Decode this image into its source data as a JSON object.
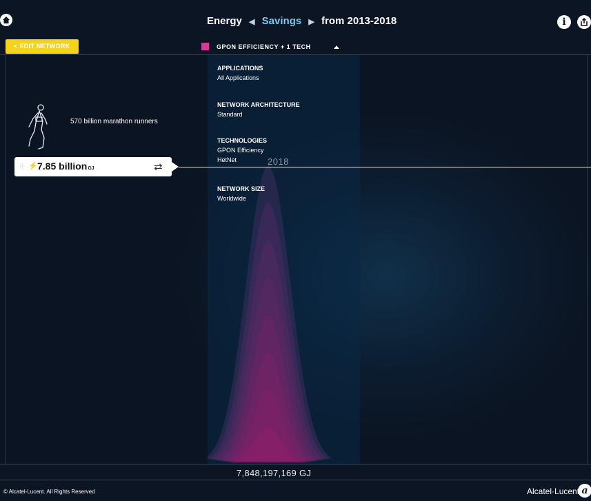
{
  "header": {
    "metric": "Energy",
    "mode": "Savings",
    "period": "from 2013-2018",
    "icons": {
      "home": "home-icon",
      "info": "info-icon",
      "share": "share-icon"
    }
  },
  "toolbar": {
    "edit_label": "< EDIT NETWORK",
    "legend_label": "GPON EFFICIENCY + 1 TECH",
    "legend_color": "#d63a97"
  },
  "comparison": {
    "text": "570 billion marathon runners"
  },
  "specs": {
    "applications": {
      "heading": "APPLICATIONS",
      "value": "All Applications"
    },
    "architecture": {
      "heading": "NETWORK ARCHITECTURE",
      "value": "Standard"
    },
    "technologies": {
      "heading": "TECHNOLOGIES",
      "value1": "GPON Efficiency",
      "value2": "HetNet"
    },
    "size": {
      "heading": "NETWORK SIZE",
      "value": "Worldwide"
    }
  },
  "value_box": {
    "value": "7.85 billion",
    "unit": "GJ"
  },
  "chart_data": {
    "type": "area",
    "year_label": "2018",
    "total_label": "7,848,197,169 GJ",
    "series_color": "#d63a97",
    "layers": 8
  },
  "footer": {
    "copyright": "© Alcatel-Lucent. All Rights Reserved",
    "brand": "Alcatel·Lucent"
  }
}
